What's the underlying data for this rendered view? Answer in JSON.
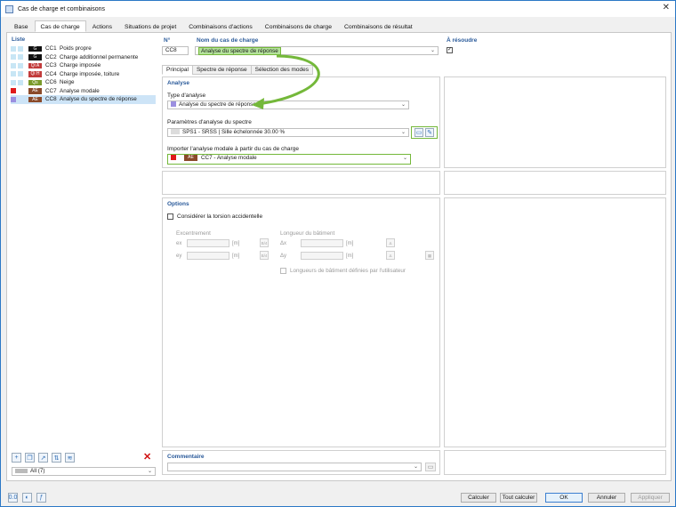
{
  "window": {
    "title": "Cas de charge et combinaisons",
    "close": "✕"
  },
  "tabs": [
    "Base",
    "Cas de charge",
    "Actions",
    "Situations de projet",
    "Combinaisons d'actions",
    "Combinaisons de charge",
    "Combinaisons de résultat"
  ],
  "list": {
    "title": "Liste",
    "items": [
      {
        "color": "#c8e6f5",
        "badge": "G",
        "badge_color": "#111111",
        "id": "CC1",
        "name": "Poids propre"
      },
      {
        "color": "#c8e6f5",
        "badge": "G",
        "badge_color": "#111111",
        "id": "CC2",
        "name": "Charge additionnel permanente"
      },
      {
        "color": "#c8e6f5",
        "badge": "Qi A",
        "badge_color": "#c23b3b",
        "id": "CC3",
        "name": "Charge imposée"
      },
      {
        "color": "#c8e6f5",
        "badge": "Qi H",
        "badge_color": "#c23b3b",
        "id": "CC4",
        "name": "Charge imposée, toiture"
      },
      {
        "color": "#c8e6f5",
        "badge": "Qs",
        "badge_color": "#7a9a2a",
        "id": "CC6",
        "name": "Neige"
      },
      {
        "color": "#e01a1a",
        "badge": "AE",
        "badge_color": "#8a4a2a",
        "id": "CC7",
        "name": "Analyse modale"
      },
      {
        "color": "#9b8fe0",
        "badge": "AE",
        "badge_color": "#8a4a2a",
        "id": "CC8",
        "name": "Analyse du spectre de réponse"
      }
    ],
    "filter": "All (7)"
  },
  "header": {
    "no_label": "N°",
    "no_value": "CC8",
    "name_label": "Nom du cas de charge",
    "name_value": "Analyse du spectre de réponse",
    "solve_label": "À résoudre"
  },
  "subtabs": [
    "Principal",
    "Spectre de réponse",
    "Sélection des modes"
  ],
  "analyse": {
    "title": "Analyse",
    "type_label": "Type d'analyse",
    "type_value": "Analyse du spectre de réponse",
    "params_label": "Paramètres d'analyse du spectre",
    "params_value": "SPS1 - SRSS | Sille échelonnée 30.00 %",
    "import_label": "Importer l'analyse modale à partir du cas de charge",
    "import_badge": "AE",
    "import_value": "CC7 - Analyse modale"
  },
  "options": {
    "title": "Options",
    "torsion_label": "Considérer la torsion accidentelle",
    "excentrement_label": "Excentrement",
    "longueur_label": "Longueur du bâtiment",
    "ex": "ex",
    "ey": "ey",
    "dx": "Δx",
    "dy": "Δy",
    "unit": "[m]",
    "user_lengths_label": "Longueurs de bâtiment définies par l'utilisateur"
  },
  "comment": {
    "title": "Commentaire"
  },
  "buttons": {
    "calc": "Calculer",
    "calc_all": "Tout calculer",
    "ok": "OK",
    "cancel": "Annuler",
    "apply": "Appliquer"
  },
  "colors": {
    "accent": "#2a5a9a",
    "green_highlight": "#74b83a",
    "selection": "#cde4f7"
  }
}
